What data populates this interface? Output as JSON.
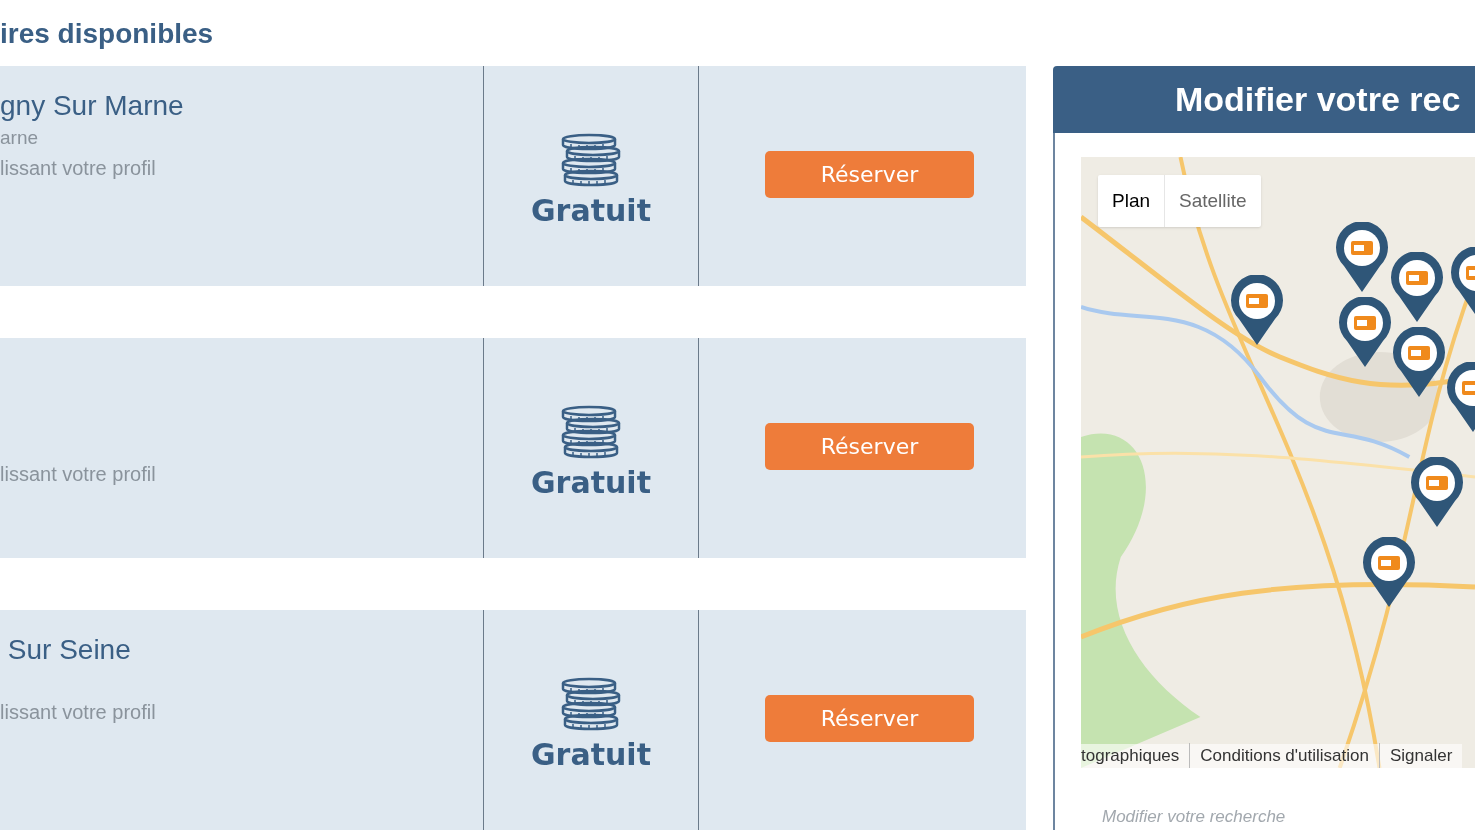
{
  "heading": "ires disponibles",
  "listings": [
    {
      "title": "gny Sur Marne",
      "subtitle": "arne",
      "note": "lissant votre profil",
      "price": "Gratuit",
      "button": "Réserver"
    },
    {
      "note": "lissant votre profil",
      "price": "Gratuit",
      "button": "Réserver"
    },
    {
      "title": " Sur Seine",
      "note": "lissant votre profil",
      "price": "Gratuit",
      "button": "Réserver"
    }
  ],
  "panel": {
    "title": "Modifier votre rec",
    "map": {
      "kind": "picture",
      "map_types": [
        {
          "label": "Plan",
          "selected": true
        },
        {
          "label": "Satellite",
          "selected": false
        }
      ],
      "attribution": [
        "tographiques",
        "Conditions d'utilisation",
        "Signaler"
      ]
    },
    "link": "Modifier votre recherche"
  }
}
